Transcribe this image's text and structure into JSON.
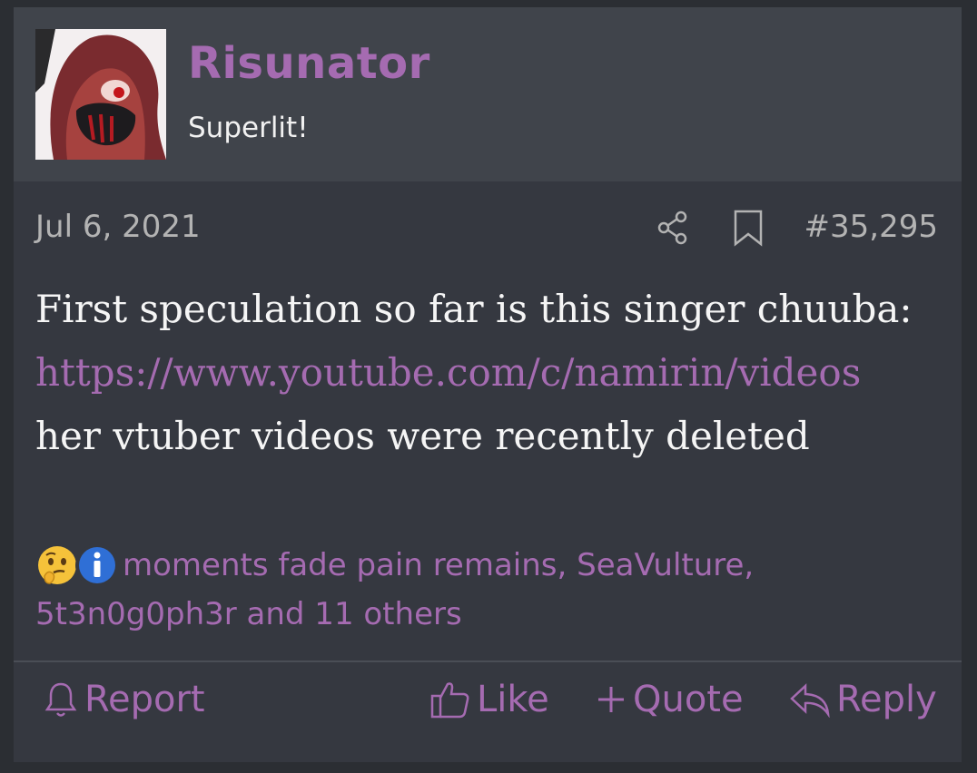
{
  "user": {
    "name": "Risunator",
    "title": "Superlit!"
  },
  "meta": {
    "date": "Jul 6, 2021",
    "post_number": "#35,295"
  },
  "body": {
    "line1": "First speculation so far is this singer chuuba:",
    "link": "https://www.youtube.com/c/namirin/videos",
    "line3": "her vtuber videos were recently deleted"
  },
  "reactions": {
    "icons": [
      "thinking-face-icon",
      "info-icon"
    ],
    "names": "moments fade pain remains, SeaVulture, 5t3n0g0ph3r and 11 others"
  },
  "actions": {
    "report": "Report",
    "like": "Like",
    "quote": "Quote",
    "reply": "Reply"
  },
  "colors": {
    "accent": "#a56bb1",
    "background": "#353840",
    "header": "#40444b"
  }
}
